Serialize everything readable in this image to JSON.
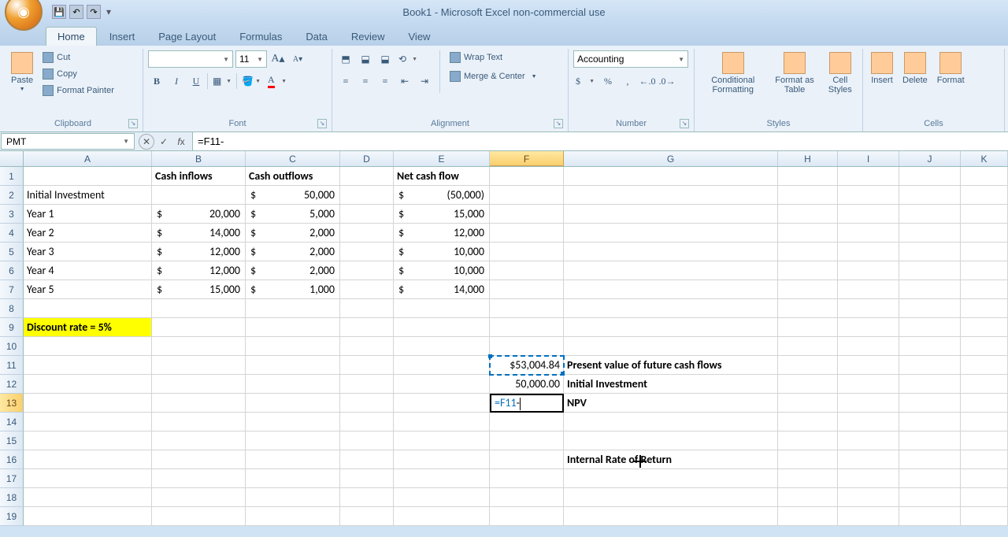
{
  "window": {
    "title": "Book1 - Microsoft Excel non-commercial use"
  },
  "tabs": {
    "home": "Home",
    "insert": "Insert",
    "page_layout": "Page Layout",
    "formulas": "Formulas",
    "data": "Data",
    "review": "Review",
    "view": "View"
  },
  "ribbon": {
    "clipboard": {
      "title": "Clipboard",
      "paste": "Paste",
      "cut": "Cut",
      "copy": "Copy",
      "format_painter": "Format Painter"
    },
    "font": {
      "title": "Font",
      "name": "",
      "size": "11",
      "bold": "B",
      "italic": "I",
      "underline": "U",
      "grow": "A",
      "shrink": "A"
    },
    "alignment": {
      "title": "Alignment",
      "wrap": "Wrap Text",
      "merge": "Merge & Center"
    },
    "number": {
      "title": "Number",
      "format": "Accounting",
      "currency": "$",
      "percent": "%",
      "comma": ",",
      "inc": "⁰₊",
      "dec": "⁰₋"
    },
    "styles": {
      "title": "Styles",
      "conditional": "Conditional Formatting",
      "table": "Format as Table",
      "cell": "Cell Styles"
    },
    "cells": {
      "title": "Cells",
      "insert": "Insert",
      "delete": "Delete",
      "format": "Format"
    }
  },
  "formula_bar": {
    "name_box": "PMT",
    "formula": "=F11-"
  },
  "columns": [
    "A",
    "B",
    "C",
    "D",
    "E",
    "F",
    "G",
    "H",
    "I",
    "J",
    "K"
  ],
  "rows": [
    "1",
    "2",
    "3",
    "4",
    "5",
    "6",
    "7",
    "8",
    "9",
    "10",
    "11",
    "12",
    "13",
    "14",
    "15",
    "16",
    "17",
    "18",
    "19"
  ],
  "sheet": {
    "B1": "Cash inflows",
    "C1": "Cash outflows",
    "E1": "Net cash flow",
    "A2": "Initial Investment",
    "C2s": "$",
    "C2v": "50,000",
    "E2s": "$",
    "E2v": "(50,000)",
    "A3": "Year 1",
    "B3s": "$",
    "B3v": "20,000",
    "C3s": "$",
    "C3v": "5,000",
    "E3s": "$",
    "E3v": "15,000",
    "A4": "Year 2",
    "B4s": "$",
    "B4v": "14,000",
    "C4s": "$",
    "C4v": "2,000",
    "E4s": "$",
    "E4v": "12,000",
    "A5": "Year 3",
    "B5s": "$",
    "B5v": "12,000",
    "C5s": "$",
    "C5v": "2,000",
    "E5s": "$",
    "E5v": "10,000",
    "A6": "Year 4",
    "B6s": "$",
    "B6v": "12,000",
    "C6s": "$",
    "C6v": "2,000",
    "E6s": "$",
    "E6v": "10,000",
    "A7": "Year 5",
    "B7s": "$",
    "B7v": "15,000",
    "C7s": "$",
    "C7v": "1,000",
    "E7s": "$",
    "E7v": "14,000",
    "A9": "Discount rate = 5%",
    "F11": "$53,004.84",
    "G11": "Present value of future cash flows",
    "F12": "50,000.00",
    "G12": "Initial Investment",
    "F13": "=F11-",
    "G13": "NPV",
    "G16": "Internal Rate of Return"
  },
  "active": {
    "col": "F",
    "row": "13"
  }
}
